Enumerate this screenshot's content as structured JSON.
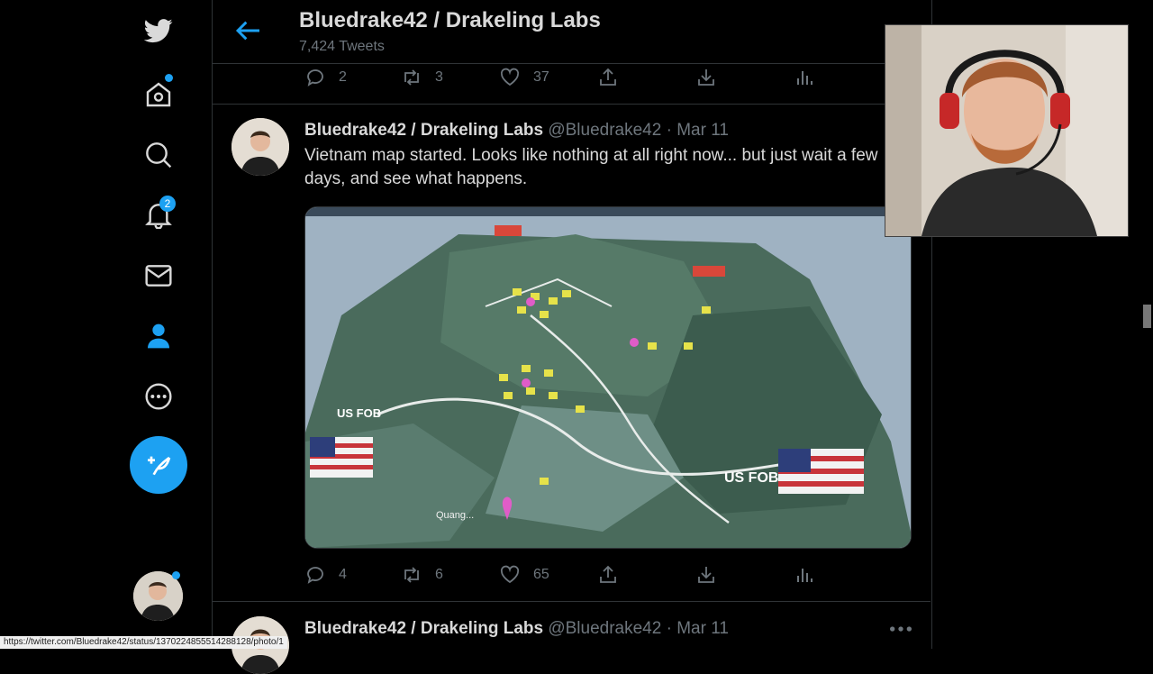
{
  "header": {
    "title": "Bluedrake42 / Drakeling Labs",
    "tweet_count": "7,424 Tweets"
  },
  "colors": {
    "accent": "#1da1f2",
    "background": "#000000",
    "text": "#d9d9d9",
    "muted": "#6e767d"
  },
  "sidebar": {
    "items": [
      {
        "name": "twitter-logo"
      },
      {
        "name": "home",
        "has_dot": true
      },
      {
        "name": "explore"
      },
      {
        "name": "notifications",
        "badge": "2"
      },
      {
        "name": "messages"
      },
      {
        "name": "profile",
        "active": true
      },
      {
        "name": "more"
      }
    ],
    "compose": "compose-tweet"
  },
  "previous_tweet": {
    "replies": "2",
    "retweets": "3",
    "likes": "37"
  },
  "tweet": {
    "author": "Bluedrake42 / Drakeling Labs",
    "handle": "@Bluedrake42",
    "separator": "·",
    "date": "Mar 11",
    "text": "Vietnam map started. Looks like nothing at all right now... but just wait a few days, and see what happens.",
    "media_labels": {
      "fob_left": "US FOB",
      "fob_right": "US FOB",
      "town": "Quang..."
    },
    "replies": "4",
    "retweets": "6",
    "likes": "65"
  },
  "next_tweet": {
    "author": "Bluedrake42 / Drakeling Labs",
    "handle": "@Bluedrake42",
    "separator": "·",
    "date": "Mar 11"
  },
  "status_url": "https://twitter.com/Bluedrake42/status/1370224855514288128/photo/1"
}
